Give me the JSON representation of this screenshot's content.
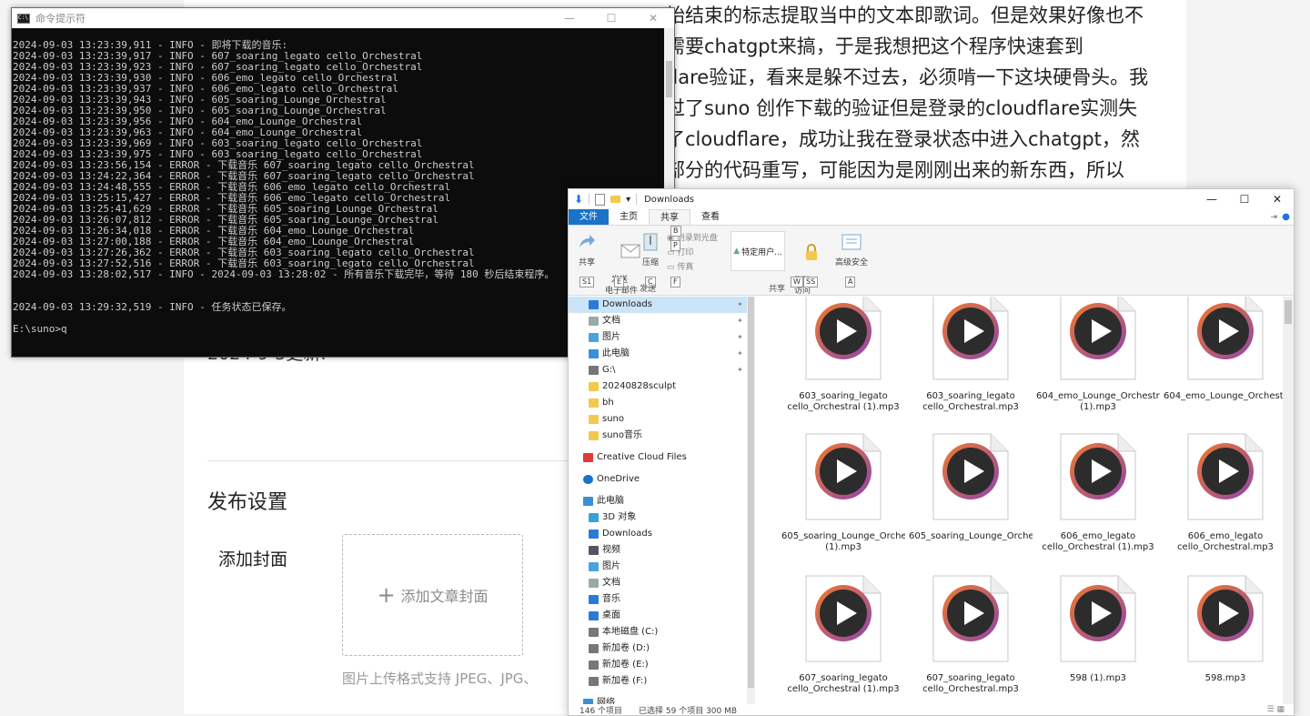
{
  "article": {
    "lines": [
      "始结束的标志提取当中的文本即歌词。但是效果好像也不",
      "需要chatgpt来搞，于是我想把这个程序快速套到",
      "flare验证，看来是躲不过去，必须啃一下这块硬骨头。我",
      "过了suno 创作下载的验证但是登录的cloudflare实测失",
      "了cloudflare，成功让我在登录状态中进入chatgpt，然",
      "部分的代码重写，可能因为是刚刚出来的新东西，所以"
    ],
    "update_line": "2024-9-3更新:",
    "section_title": "发布设置",
    "cover_label": "添加封面",
    "cover_button": "添加文章封面",
    "cover_plus": "+",
    "cover_hint": "图片上传格式支持 JPEG、JPG、"
  },
  "cmd": {
    "title": "命令提示符",
    "icon_text": "C:\\",
    "controls": [
      "—",
      "☐",
      "✕"
    ],
    "lines": [
      "2024-09-03 13:23:39,911 - INFO - 即将下载的音乐:",
      "2024-09-03 13:23:39,917 - INFO - 607_soaring_legato cello_Orchestral",
      "2024-09-03 13:23:39,923 - INFO - 607_soaring_legato cello_Orchestral",
      "2024-09-03 13:23:39,930 - INFO - 606_emo_legato cello_Orchestral",
      "2024-09-03 13:23:39,937 - INFO - 606_emo_legato cello_Orchestral",
      "2024-09-03 13:23:39,943 - INFO - 605_soaring_Lounge_Orchestral",
      "2024-09-03 13:23:39,950 - INFO - 605_soaring_Lounge_Orchestral",
      "2024-09-03 13:23:39,956 - INFO - 604_emo_Lounge_Orchestral",
      "2024-09-03 13:23:39,963 - INFO - 604_emo_Lounge_Orchestral",
      "2024-09-03 13:23:39,969 - INFO - 603_soaring_legato cello_Orchestral",
      "2024-09-03 13:23:39,975 - INFO - 603_soaring_legato cello_Orchestral",
      "2024-09-03 13:23:56,154 - ERROR - 下载音乐 607_soaring_legato cello_Orchestral",
      "2024-09-03 13:24:22,364 - ERROR - 下载音乐 607_soaring_legato cello_Orchestral",
      "2024-09-03 13:24:48,555 - ERROR - 下载音乐 606_emo_legato cello_Orchestral",
      "2024-09-03 13:25:15,427 - ERROR - 下载音乐 606_emo_legato cello_Orchestral",
      "2024-09-03 13:25:41,629 - ERROR - 下载音乐 605_soaring_Lounge_Orchestral",
      "2024-09-03 13:26:07,812 - ERROR - 下载音乐 605_soaring_Lounge_Orchestral",
      "2024-09-03 13:26:34,018 - ERROR - 下载音乐 604_emo_Lounge_Orchestral",
      "2024-09-03 13:27:00,188 - ERROR - 下载音乐 604_emo_Lounge_Orchestral",
      "2024-09-03 13:27:26,362 - ERROR - 下载音乐 603_soaring_legato cello_Orchestral",
      "2024-09-03 13:27:52,516 - ERROR - 下载音乐 603_soaring_legato cello_Orchestral",
      "2024-09-03 13:28:02,517 - INFO - 2024-09-03 13:28:02 - 所有音乐下载完毕，等待 180 秒后结束程序。",
      "",
      "",
      "2024-09-03 13:29:32,519 - INFO - 任务状态已保存。",
      "",
      "E:\\suno>q"
    ]
  },
  "explorer": {
    "title": "Downloads",
    "controls": [
      "—",
      "☐",
      "✕"
    ],
    "tabs": [
      "文件",
      "主页",
      "共享",
      "查看"
    ],
    "ribbon": {
      "share": "共享",
      "email": "发送\n电子邮件",
      "zip": "压缩",
      "burn": "刻录到光盘",
      "print": "打印",
      "fax": "传真",
      "send_group": "发送",
      "specific_users": "特定用户...",
      "remove_access": "删除\n访问",
      "share_group": "共享",
      "advanced_security": "高级安全",
      "keys": [
        "S1",
        "E",
        "C",
        "B",
        "P",
        "F",
        "W",
        "SS",
        "A"
      ]
    },
    "nav": [
      {
        "label": "Downloads",
        "icon": "download-icon",
        "pinned": true,
        "selected": true
      },
      {
        "label": "文档",
        "icon": "document-icon",
        "pinned": true
      },
      {
        "label": "图片",
        "icon": "picture-icon",
        "pinned": true
      },
      {
        "label": "此电脑",
        "icon": "computer-icon",
        "pinned": true
      },
      {
        "label": "G:\\",
        "icon": "drive-icon",
        "pinned": true
      },
      {
        "label": "20240828sculpt",
        "icon": "folder-icon"
      },
      {
        "label": "bh",
        "icon": "folder-icon"
      },
      {
        "label": "suno",
        "icon": "folder-icon"
      },
      {
        "label": "suno音乐",
        "icon": "folder-icon"
      },
      {
        "label": "Creative Cloud Files",
        "icon": "creative-cloud-icon"
      },
      {
        "label": "OneDrive",
        "icon": "onedrive-icon"
      },
      {
        "label": "此电脑",
        "icon": "computer-icon"
      },
      {
        "label": "3D 对象",
        "icon": "3d-objects-icon"
      },
      {
        "label": "Downloads",
        "icon": "download-icon"
      },
      {
        "label": "视频",
        "icon": "video-icon"
      },
      {
        "label": "图片",
        "icon": "picture-icon"
      },
      {
        "label": "文档",
        "icon": "document-icon"
      },
      {
        "label": "音乐",
        "icon": "music-icon"
      },
      {
        "label": "桌面",
        "icon": "desktop-icon"
      },
      {
        "label": "本地磁盘 (C:)",
        "icon": "drive-icon"
      },
      {
        "label": "新加卷 (D:)",
        "icon": "drive-icon"
      },
      {
        "label": "新加卷 (E:)",
        "icon": "drive-icon"
      },
      {
        "label": "新加卷 (F:)",
        "icon": "drive-icon"
      },
      {
        "label": "网络",
        "icon": "network-icon"
      }
    ],
    "files": [
      "603_soaring_legato cello_Orchestral (1).mp3",
      "603_soaring_legato cello_Orchestral.mp3",
      "604_emo_Lounge_Orchestral (1).mp3",
      "604_emo_Lounge_Orchestral.mp3",
      "605_soaring_Lounge_Orchestral (1).mp3",
      "605_soaring_Lounge_Orchestral.mp3",
      "606_emo_legato cello_Orchestral (1).mp3",
      "606_emo_legato cello_Orchestral.mp3",
      "607_soaring_legato cello_Orchestral (1).mp3",
      "607_soaring_legato cello_Orchestral.mp3",
      "598 (1).mp3",
      "598.mp3"
    ],
    "status": {
      "count": "146 个项目",
      "selected": "已选择 59 个项目  300 MB"
    }
  },
  "colors": {
    "accent": "#1a73c8",
    "terminal_bg": "#0c0c0c",
    "terminal_fg": "#cccccc",
    "play_ring_orange": "#f07a2b",
    "play_ring_purple": "#8e44ad"
  }
}
